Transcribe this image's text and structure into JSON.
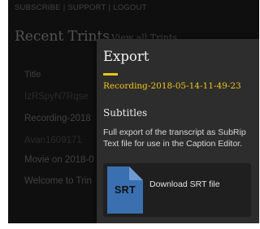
{
  "topnav": {
    "items": [
      "SUBSCRIBE",
      "SUPPORT",
      "LOGOUT"
    ]
  },
  "recent": {
    "title": "Recent Trints",
    "view_all": "View all Trints",
    "column_title": "Title",
    "rows": [
      "IzRSpyN7Rqse",
      "Recording-2018",
      "Avan1609171",
      "Movie on 2018-0",
      "Welcome to Trin"
    ]
  },
  "export": {
    "title": "Export",
    "recording_name": "Recording-2018-05-14-11-49-23",
    "subtitles_heading": "Subtitles",
    "description": "Full export of the transcript as SubRip Text file for use in the Caption Editor.",
    "download": {
      "badge": "SRT",
      "label": "Download SRT file"
    },
    "accent_color": "#f2c418",
    "icon_color": "#3a6fb0"
  }
}
